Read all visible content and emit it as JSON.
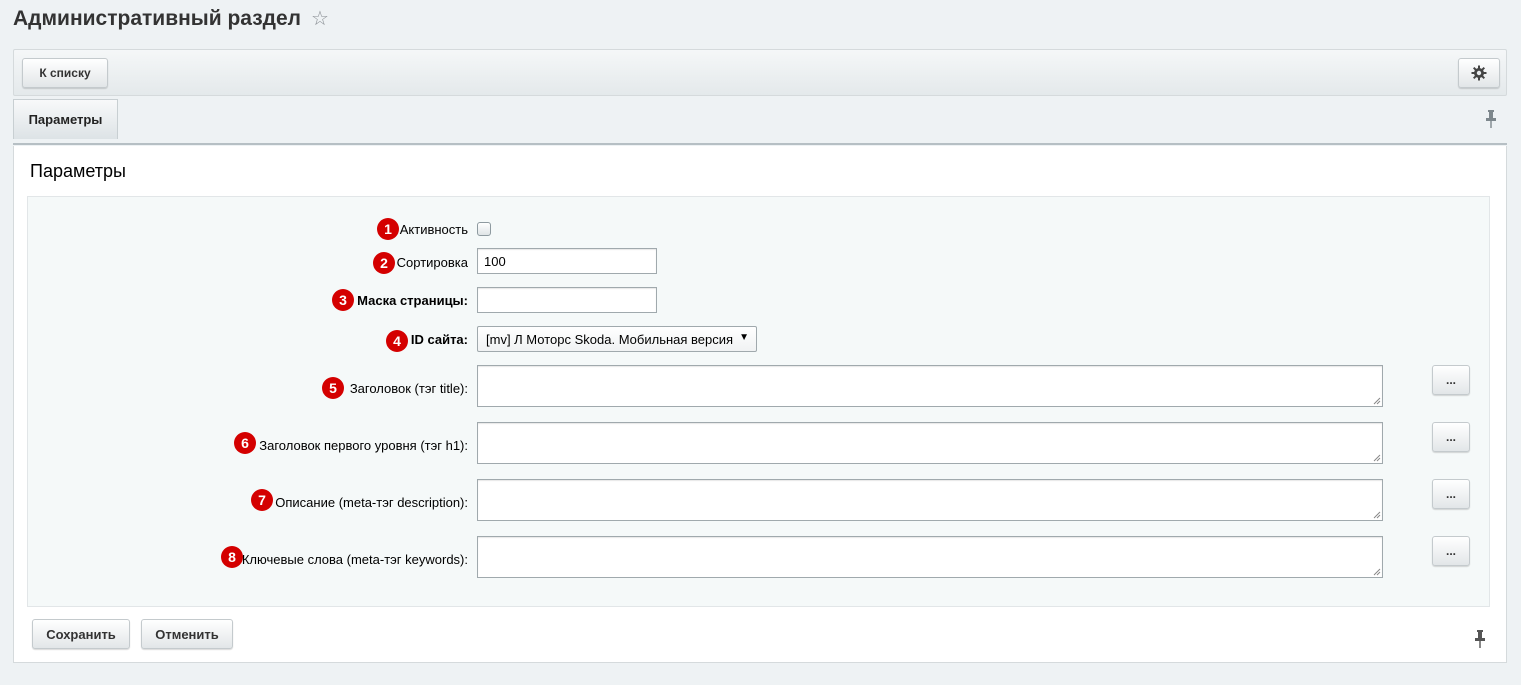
{
  "page": {
    "title": "Административный раздел",
    "favorite_icon": "star-icon"
  },
  "toolbar": {
    "back_label": "К списку",
    "settings_icon": "gear-icon"
  },
  "tabs": [
    {
      "label": "Параметры",
      "active": true
    }
  ],
  "section": {
    "title": "Параметры"
  },
  "fields": {
    "active": {
      "marker": "1",
      "label": "Активность",
      "checked": false
    },
    "sort": {
      "marker": "2",
      "label": "Сортировка",
      "value": "100"
    },
    "page_mask": {
      "marker": "3",
      "label": "Маска страницы:",
      "value": ""
    },
    "site_id": {
      "marker": "4",
      "label": "ID сайта:",
      "value": "[mv] Л Моторс Skoda. Мобильная версия"
    },
    "title_tag": {
      "marker": "5",
      "label": "Заголовок (тэг title):",
      "value": "",
      "button": "..."
    },
    "h1_tag": {
      "marker": "6",
      "label": "Заголовок первого уровня (тэг h1):",
      "value": "",
      "button": "..."
    },
    "description": {
      "marker": "7",
      "label": "Описание (meta-тэг description):",
      "value": "",
      "button": "..."
    },
    "keywords": {
      "marker": "8",
      "label": "Ключевые слова (meta-тэг keywords):",
      "value": "",
      "button": "..."
    }
  },
  "footer": {
    "save_label": "Сохранить",
    "cancel_label": "Отменить",
    "pin_icon": "pin-icon"
  },
  "colors": {
    "marker": "#d40000",
    "background": "#eef2f4"
  }
}
